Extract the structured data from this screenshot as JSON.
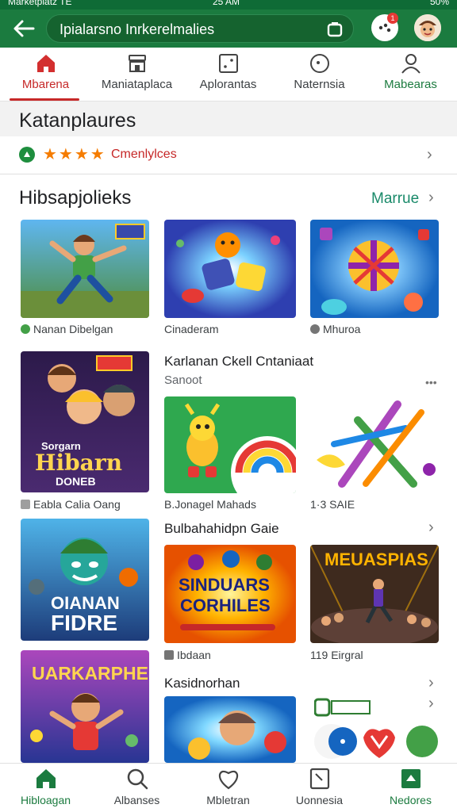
{
  "status_bar": {
    "left": "Marketplatz  TE",
    "time": "25 AM",
    "right": "50%"
  },
  "app_bar": {
    "search_text": "Ipialarsno Inrkerelmalies",
    "badge_count": "1"
  },
  "tabs": [
    {
      "label": "Mbarena",
      "icon": "home-icon",
      "active": true
    },
    {
      "label": "Maniataplaca",
      "icon": "store-icon",
      "active": false
    },
    {
      "label": "Aplorantas",
      "icon": "apps-icon",
      "active": false
    },
    {
      "label": "Naternsia",
      "icon": "games-icon",
      "active": false
    },
    {
      "label": "Mabearas",
      "icon": "person-icon",
      "active": false
    }
  ],
  "section_grey": {
    "title": "Katanplaures"
  },
  "rating_row": {
    "stars": "★★★★",
    "text": "Cmenlylces"
  },
  "section_main": {
    "title": "Hibsapjolieks",
    "link": "Marrue"
  },
  "cards": {
    "c1": {
      "caption": "Nanan Dibelgan"
    },
    "c2": {
      "caption": "Cinaderam"
    },
    "c3": {
      "caption": "Mhuroa"
    },
    "c4": {
      "caption": "Eabla Calia Oang",
      "art_text_1": "Hibarn",
      "art_text_2": "DONEB",
      "art_text_3": "Sorgarn"
    },
    "row1": {
      "title": "Karlanan Ckell Cntaniaat",
      "subtitle": "Sanoot",
      "more": "•••"
    },
    "c5": {
      "caption": "B.Jonagel Mahads"
    },
    "c6": {
      "caption": "1·3 SAIE"
    },
    "row2": {
      "title": "Bulbahahidpn Gaie"
    },
    "c7": {
      "caption": "",
      "art_text_1": "OIANAN",
      "art_text_2": "FIDRE"
    },
    "c8": {
      "caption": "Ibdaan",
      "art_text_1": "SINDUARS",
      "art_text_2": "CORHILES"
    },
    "c9": {
      "caption": "119 Eirgral",
      "art_text_1": "MEUASPIAS"
    },
    "row3": {
      "title": "Kasidnorhan"
    },
    "c10": {
      "art_text_1": "UARKARPHES"
    }
  },
  "bottom_nav": [
    {
      "label": "Hibloagan",
      "icon": "home-icon",
      "active": true
    },
    {
      "label": "Albanses",
      "icon": "search-icon",
      "active": false
    },
    {
      "label": "Mbletran",
      "icon": "heart-icon",
      "active": false
    },
    {
      "label": "Uonnesia",
      "icon": "book-icon",
      "active": false
    },
    {
      "label": "Nedores",
      "icon": "grid-icon",
      "active": false
    }
  ],
  "colors": {
    "brand_green": "#1b7b3f",
    "accent_red": "#c62828",
    "star_orange": "#f57c00"
  }
}
